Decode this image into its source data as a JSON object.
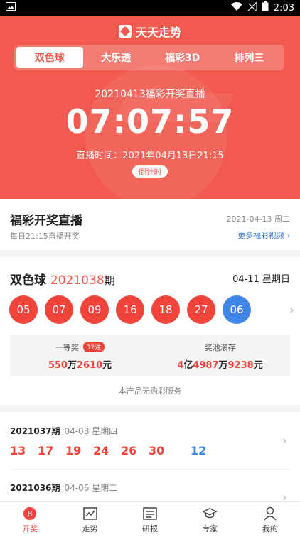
{
  "status": {
    "time": "2:03"
  },
  "app": {
    "name": "天天走势"
  },
  "tabs": [
    {
      "label": "双色球"
    },
    {
      "label": "大乐透"
    },
    {
      "label": "福彩3D"
    },
    {
      "label": "排列三"
    }
  ],
  "hero": {
    "period_title": "20210413福彩开奖直播",
    "countdown": "07:07:57",
    "live_time": "直播时间：2021年04月13日21:15",
    "countdown_label": "倒计时"
  },
  "live": {
    "title": "福彩开奖直播",
    "subtitle": "每日21:15直播开奖",
    "date": "2021-04-13 周二",
    "more": "更多福彩视频"
  },
  "result": {
    "game": "双色球",
    "issue": "2021038",
    "issue_suffix": "期",
    "date": "04-11 星期日",
    "red_balls": [
      "05",
      "07",
      "09",
      "16",
      "18",
      "27"
    ],
    "blue_ball": "06",
    "first_prize": {
      "label": "一等奖",
      "count": "32注",
      "amount_a": "550",
      "unit_a": "万",
      "amount_b": "2610",
      "unit_b": "元"
    },
    "pool": {
      "label": "奖池滚存",
      "a": "4",
      "unit_a": "亿",
      "b": "4987",
      "unit_b": "万",
      "c": "9238",
      "unit_c": "元"
    },
    "notice": "本产品无购彩服务"
  },
  "history": [
    {
      "issue": "2021037期",
      "date": "04-08 星期四",
      "reds": [
        "13",
        "17",
        "19",
        "24",
        "26",
        "30"
      ],
      "blue": "12"
    },
    {
      "issue": "2021036期",
      "date": "04-06 星期二",
      "reds": [],
      "blue": ""
    }
  ],
  "nav": [
    {
      "label": "开奖",
      "icon": "lottery-icon",
      "badge": "8"
    },
    {
      "label": "走势",
      "icon": "trend-chart-icon"
    },
    {
      "label": "研报",
      "icon": "report-icon"
    },
    {
      "label": "专家",
      "icon": "expert-icon"
    },
    {
      "label": "我的",
      "icon": "profile-icon"
    }
  ],
  "colors": {
    "brand_red": "#f25a4f",
    "ball_red": "#f0443b",
    "ball_blue": "#3f86e8",
    "link_blue": "#3c7bd8"
  }
}
